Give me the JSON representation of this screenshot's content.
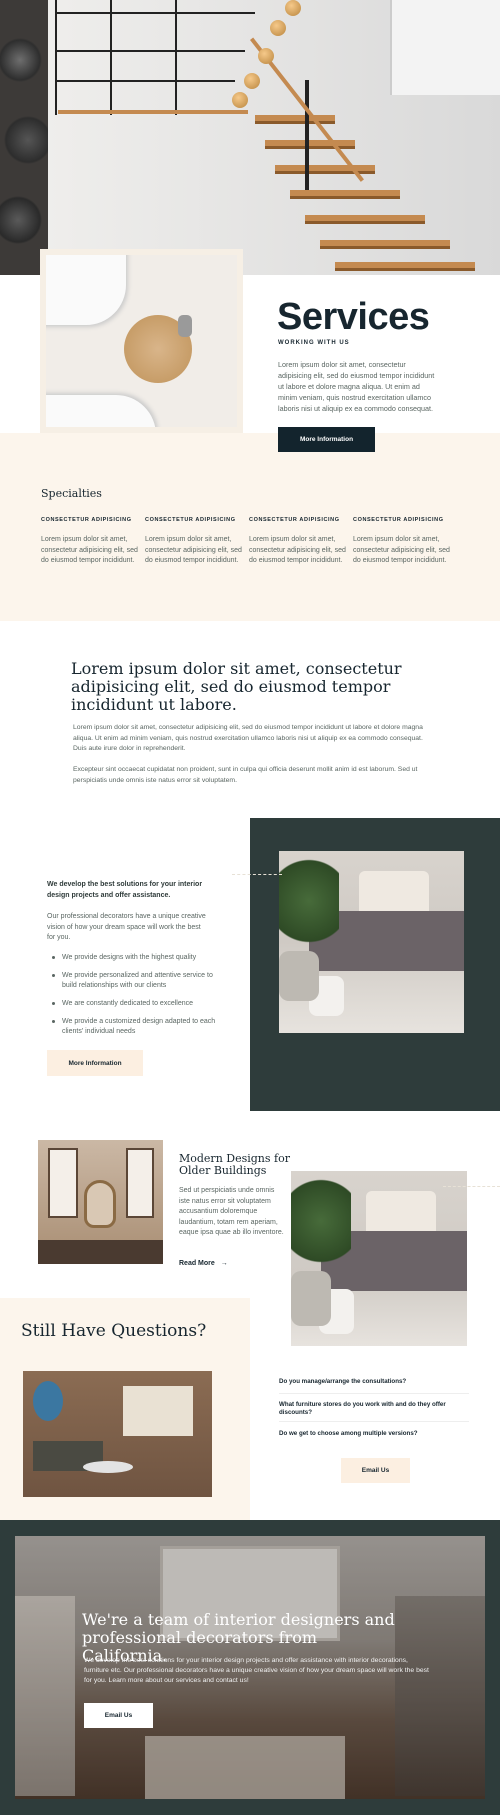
{
  "services": {
    "title": "Services",
    "subtitle": "WORKING WITH US",
    "body": "Lorem ipsum dolor sit amet, consectetur adipisicing elit, sed do eiusmod tempor incididunt ut labore et dolore magna aliqua. Ut enim ad minim veniam, quis nostrud exercitation ullamco laboris nisi ut aliquip ex ea commodo consequat.",
    "button": "More Information"
  },
  "specialties": {
    "title": "Specialties",
    "columns": [
      {
        "heading": "CONSECTETUR ADIPISICING",
        "body": "Lorem ipsum dolor sit amet, consectetur adipisicing elit, sed do eiusmod tempor incididunt."
      },
      {
        "heading": "CONSECTETUR ADIPISICING",
        "body": "Lorem ipsum dolor sit amet, consectetur adipisicing elit, sed do eiusmod tempor incididunt."
      },
      {
        "heading": "CONSECTETUR ADIPISICING",
        "body": "Lorem ipsum dolor sit amet, consectetur adipisicing elit, sed do eiusmod tempor incididunt."
      },
      {
        "heading": "CONSECTETUR ADIPISICING",
        "body": "Lorem ipsum dolor sit amet, consectetur adipisicing elit, sed do eiusmod tempor incididunt."
      }
    ]
  },
  "intro": {
    "heading": "Lorem ipsum dolor sit amet, consectetur adipisicing elit, sed do eiusmod tempor incididunt ut labore.",
    "para1": "Lorem ipsum dolor sit amet, consectetur adipisicing elit, sed do eiusmod tempor incididunt ut labore et dolore magna aliqua. Ut enim ad minim veniam, quis nostrud exercitation ullamco laboris nisi ut aliquip ex ea commodo consequat. Duis aute irure dolor in reprehenderit.",
    "para2": "Excepteur sint occaecat cupidatat non proident, sunt in culpa qui officia deserunt mollit anim id est laborum. Sed ut perspiciatis unde omnis iste natus error sit voluptatem."
  },
  "develop": {
    "title": "We develop the best solutions for your interior design projects and offer assistance.",
    "body": "Our professional decorators have a unique creative vision of how your dream space will work the best for you.",
    "items": [
      "We provide designs with the highest quality",
      "We provide personalized and attentive service to build relationships with our clients",
      "We are constantly dedicated to excellence",
      "We provide a customized design adapted to each clients' individual needs"
    ],
    "button": "More Information"
  },
  "modern": {
    "title": "Modern Designs for Older Buildings",
    "body": "Sed ut perspiciatis unde omnis iste natus error sit voluptatem accusantium doloremque laudantium, totam rem aperiam, eaque ipsa quae ab illo inventore.",
    "link": "Read More",
    "link_arrow": "→"
  },
  "questions": {
    "title": "Still Have Questions?",
    "faqs": [
      "Do you manage/arrange the consultations?",
      "What furniture stores do you work with and do they offer discounts?",
      "Do we get to choose among multiple versions?"
    ],
    "button": "Email Us"
  },
  "cta": {
    "heading": "We're a team of interior designers and professional decorators from California.",
    "body": "We develop the best solutions for your interior design projects and offer assistance with interior decorations, furniture etc. Our professional decorators have a unique creative vision of how your dream space will work the best for you. Learn more about our services and contact us!",
    "button": "Email Us"
  },
  "colors": {
    "navy": "#13242d",
    "cream": "#fcf5ec",
    "dark_green": "#2e3c3b"
  }
}
